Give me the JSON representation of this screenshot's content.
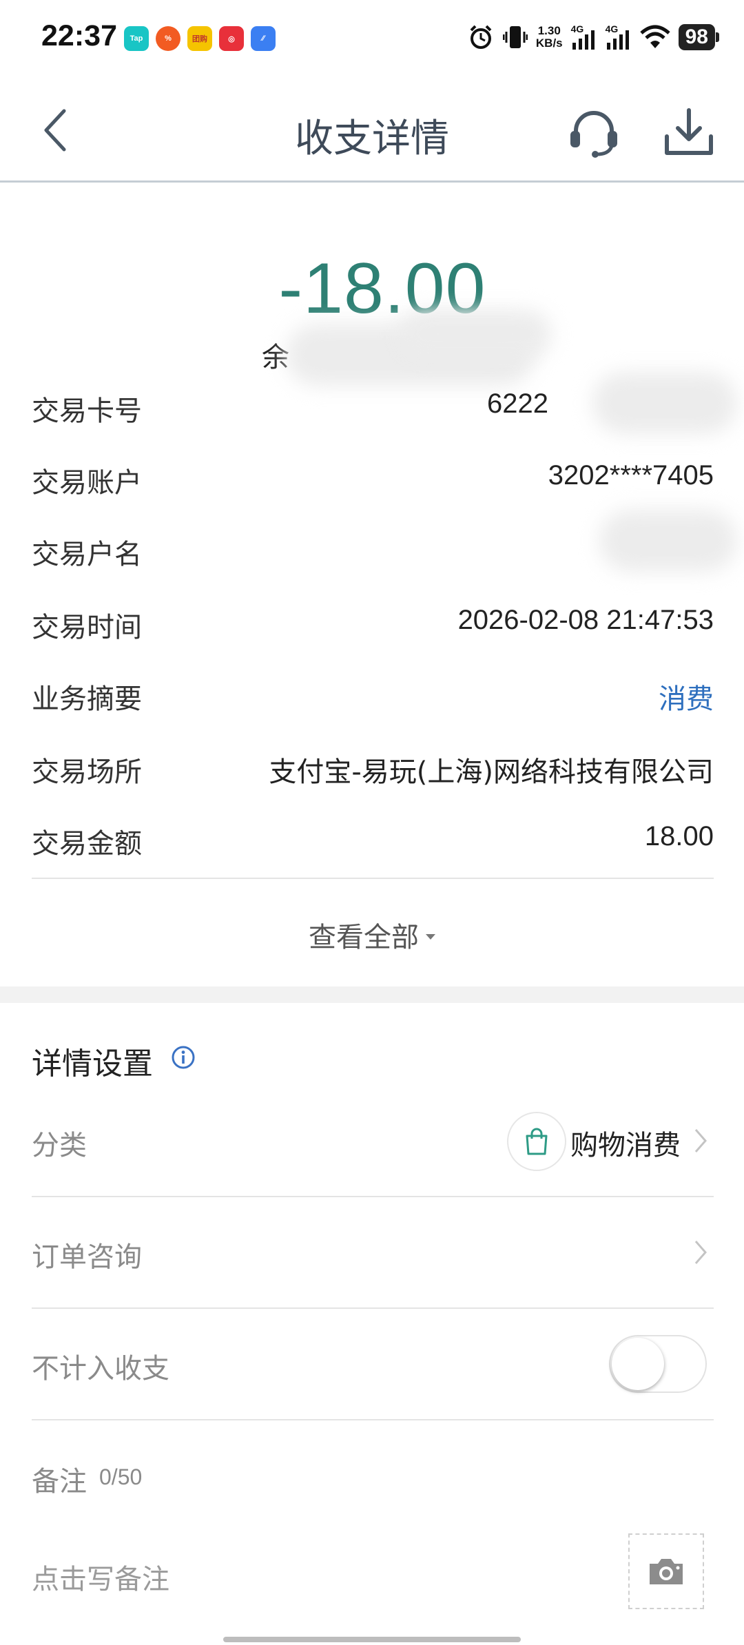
{
  "status_bar": {
    "time": "22:37",
    "apps": [
      {
        "icon": "taptap-app-icon",
        "label": "Tap",
        "color": "#19c5c5"
      },
      {
        "icon": "discount-app-icon",
        "label": "%",
        "color": "#f25b22"
      },
      {
        "icon": "meituan-app-icon",
        "label": "团购",
        "color": "#f5c400"
      },
      {
        "icon": "netease-music-app-icon",
        "label": "◎",
        "color": "#e8303a"
      },
      {
        "icon": "browser-app-icon",
        "label": "∕∕",
        "color": "#3b7ff2"
      }
    ],
    "speed_value": "1.30",
    "speed_unit": "KB/s",
    "net1": "4G",
    "net2": "4G",
    "battery": "98"
  },
  "header": {
    "title": "收支详情"
  },
  "amount": "-18.00",
  "balance_prefix": "余",
  "details": [
    {
      "label": "交易卡号",
      "value": "6222"
    },
    {
      "label": "交易账户",
      "value": "3202****7405"
    },
    {
      "label": "交易户名",
      "value": ""
    },
    {
      "label": "交易时间",
      "value": "2026-02-08 21:47:53"
    },
    {
      "label": "业务摘要",
      "value": "消费"
    },
    {
      "label": "交易场所",
      "value": "支付宝-易玩(上海)网络科技有限公司"
    },
    {
      "label": "交易金额",
      "value": "18.00"
    }
  ],
  "view_all": "查看全部",
  "settings": {
    "title": "详情设置",
    "category_label": "分类",
    "category_value": "购物消费",
    "order_label": "订单咨询",
    "exclude_label": "不计入收支",
    "exclude_on": false,
    "note_label": "备注",
    "note_count": "0/50",
    "note_placeholder": "点击写备注"
  },
  "colors": {
    "amount": "#2e8074",
    "link": "#2e6fbe",
    "title": "#3e4a59"
  }
}
